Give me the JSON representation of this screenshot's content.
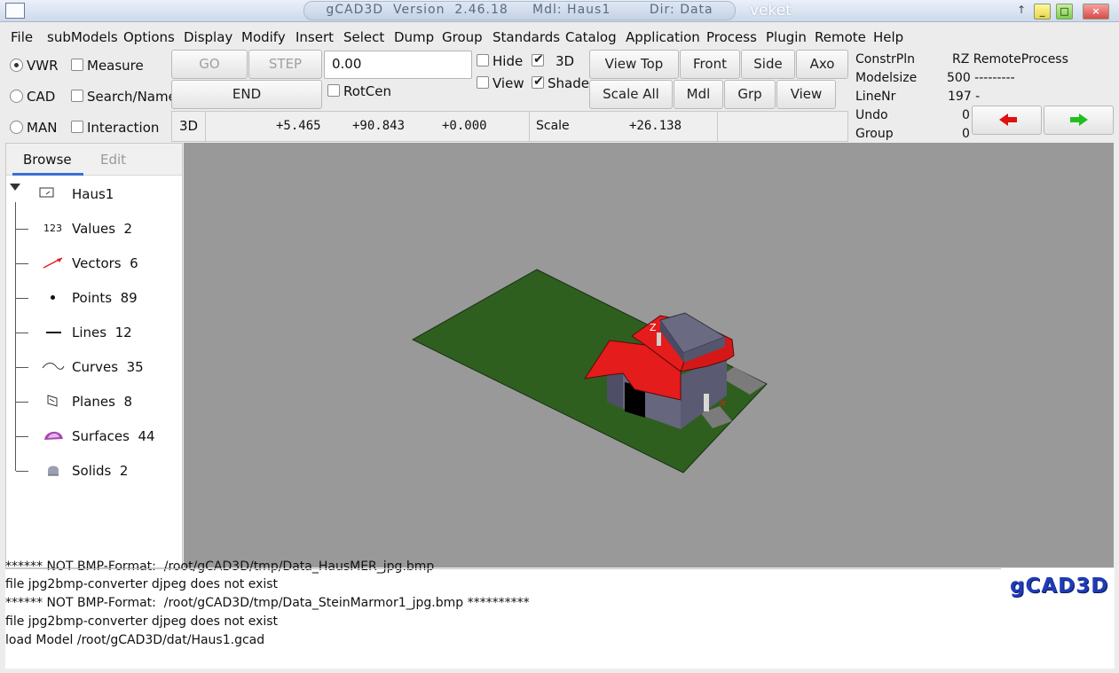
{
  "window": {
    "title": "gCAD3D  Version  2.46.18     Mdl: Haus1        Dir: Data",
    "wm_label": "veket"
  },
  "menu": [
    "File",
    "subModels",
    "Options",
    "Display",
    "Modify",
    "Insert",
    "Select",
    "Dump",
    "Group",
    "Standards",
    "Catalog",
    "Application",
    "Process",
    "Plugin",
    "Remote",
    "Help"
  ],
  "modes": [
    {
      "label": "VWR",
      "selected": true
    },
    {
      "label": "CAD",
      "selected": false
    },
    {
      "label": "MAN",
      "selected": false
    }
  ],
  "toggles": [
    {
      "label": "Measure",
      "checked": false
    },
    {
      "label": "Search/Name",
      "checked": false
    },
    {
      "label": "Interaction",
      "checked": false
    }
  ],
  "controls": {
    "go": "GO",
    "step": "STEP",
    "end": "END",
    "value_input": "0.00",
    "rotcen": "RotCen",
    "hide": "Hide",
    "view_chk": "View",
    "three_d": "3D",
    "shade": "Shade"
  },
  "view_buttons": {
    "view_top": "View  Top",
    "front": "Front",
    "side": "Side",
    "axo": "Axo",
    "scale_all": "Scale  All",
    "mdl": "Mdl",
    "grp": "Grp",
    "view": "View"
  },
  "coords": {
    "mode": "3D",
    "x": "+5.465",
    "y": "+90.843",
    "z": "+0.000",
    "scale_label": "Scale",
    "scale_value": "+26.138"
  },
  "info_panel": {
    "constrpln_label": "ConstrPln",
    "constrpln_value": "RZ RemoteProcess",
    "modelsize_label": "Modelsize",
    "modelsize_value": "500 ---------",
    "linenr_label": "LineNr",
    "linenr_value": "197 -",
    "undo_label": "Undo",
    "undo_value": "0",
    "group_label": "Group",
    "group_value": "0"
  },
  "tabs": [
    {
      "label": "Browse",
      "active": true
    },
    {
      "label": "Edit",
      "active": false
    }
  ],
  "tree": {
    "root": "Haus1",
    "items": [
      {
        "icon": "123",
        "label": "Values  2"
      },
      {
        "icon": "vector",
        "label": "Vectors  6"
      },
      {
        "icon": "point",
        "label": "Points  89"
      },
      {
        "icon": "line",
        "label": "Lines  12"
      },
      {
        "icon": "curve",
        "label": "Curves  35"
      },
      {
        "icon": "plane",
        "label": "Planes  8"
      },
      {
        "icon": "surface",
        "label": "Surfaces  44"
      },
      {
        "icon": "solid",
        "label": "Solids  2"
      }
    ]
  },
  "messages": [
    "****** NOT BMP-Format:  /root/gCAD3D/tmp/Data_HausMER_jpg.bmp",
    "file jpg2bmp-converter djpeg does not exist",
    "****** NOT BMP-Format:  /root/gCAD3D/tmp/Data_SteinMarmor1_jpg.bmp **********",
    "file jpg2bmp-converter djpeg does not exist",
    "load Model /root/gCAD3D/dat/Haus1.gcad"
  ],
  "logo": "gCAD3D",
  "colors": {
    "ground": "#2f5f1f",
    "roof": "#e41c1c",
    "walls": "#5f5f78",
    "viewport": "#999999",
    "undo_arrow": "#e01010",
    "redo_arrow": "#20c020"
  }
}
